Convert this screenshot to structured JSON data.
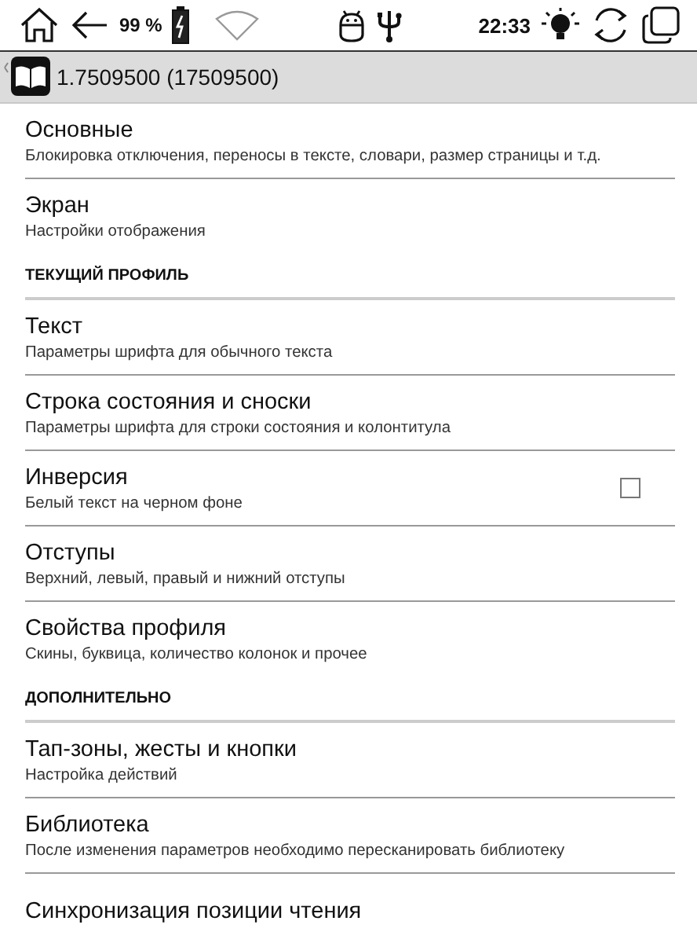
{
  "status_bar": {
    "battery_text": "99 %",
    "time": "22:33"
  },
  "action_bar": {
    "title": "1.7509500 (17509500)"
  },
  "items": [
    {
      "kind": "item",
      "title": "Основные",
      "summary": "Блокировка отключения, переносы в тексте, словари, размер страницы и т.д."
    },
    {
      "kind": "item",
      "title": "Экран",
      "summary": "Настройки отображения"
    },
    {
      "kind": "header",
      "title": "ТЕКУЩИЙ ПРОФИЛЬ"
    },
    {
      "kind": "item",
      "title": "Текст",
      "summary": "Параметры шрифта для обычного текста"
    },
    {
      "kind": "item",
      "title": "Строка состояния и сноски",
      "summary": "Параметры шрифта для строки состояния и колонтитула"
    },
    {
      "kind": "check",
      "title": "Инверсия",
      "summary": "Белый текст на черном фоне",
      "checked": false
    },
    {
      "kind": "item",
      "title": "Отступы",
      "summary": "Верхний, левый, правый и нижний отступы"
    },
    {
      "kind": "item",
      "title": "Свойства профиля",
      "summary": "Скины, буквица, количество колонок и прочее"
    },
    {
      "kind": "header",
      "title": "ДОПОЛНИТЕЛЬНО"
    },
    {
      "kind": "item",
      "title": "Тап-зоны, жесты и кнопки",
      "summary": "Настройка действий"
    },
    {
      "kind": "item",
      "title": "Библиотека",
      "summary": "После изменения параметров необходимо пересканировать библиотеку"
    },
    {
      "kind": "item",
      "title": "Синхронизация позиции чтения"
    }
  ]
}
